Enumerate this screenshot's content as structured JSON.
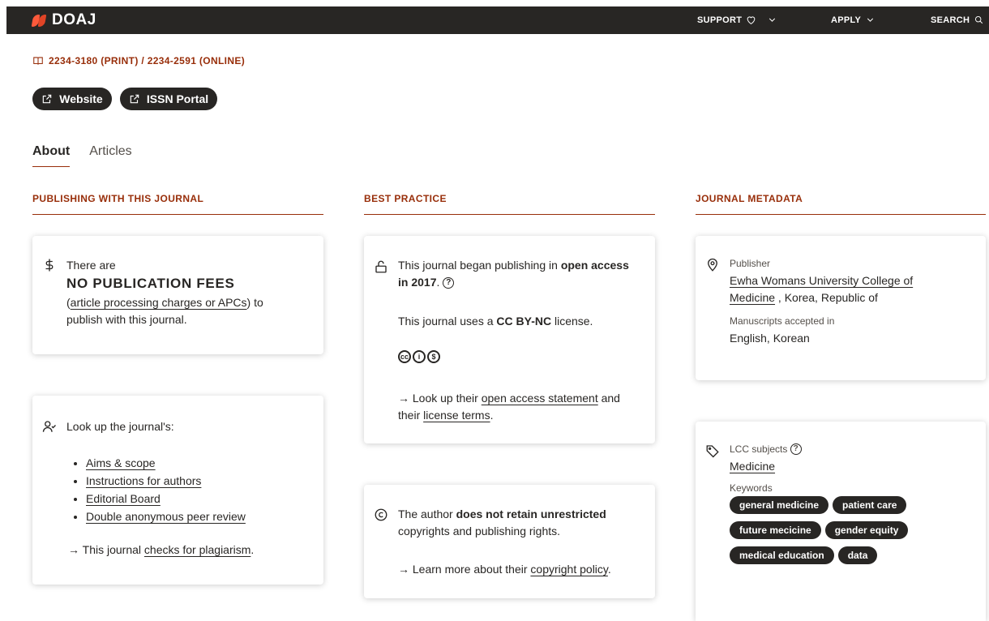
{
  "header": {
    "logo": "DOAJ",
    "support": "SUPPORT",
    "apply": "APPLY",
    "search": "SEARCH"
  },
  "issn": "2234-3180 (PRINT) / 2234-2591 (ONLINE)",
  "buttons": {
    "website": "Website",
    "issn_portal": "ISSN Portal"
  },
  "tabs": {
    "about": "About",
    "articles": "Articles"
  },
  "sections": {
    "publishing": "PUBLISHING WITH THIS JOURNAL",
    "best_practice": "BEST PRACTICE",
    "metadata": "JOURNAL METADATA"
  },
  "fees_card": {
    "there_are": "There are",
    "headline": "NO PUBLICATION FEES",
    "apc_link": "article processing charges or APCs",
    "suffix": ") to",
    "line3": "publish with this journal."
  },
  "lookup_card": {
    "title": "Look up the journal's:",
    "links": [
      "Aims & scope",
      "Instructions for authors",
      "Editorial Board",
      "Double anonymous peer review"
    ],
    "plagiarism_prefix": "→ This journal ",
    "plagiarism_link": "checks for plagiarism",
    "plagiarism_suffix": "."
  },
  "oa_card": {
    "line1": "This journal began publishing in ",
    "oa_bold1": "open access",
    "oa_bold2": "in 2017",
    "dot": ".",
    "license_prefix": "This journal uses a ",
    "license_bold": "CC BY-NC",
    "license_suffix": " license.",
    "lookup_prefix": "→ Look up their ",
    "oa_statement": "open access statement",
    "and": " and",
    "their": "their ",
    "license_terms": "license terms",
    "period": "."
  },
  "copyright_card": {
    "prefix": "The author ",
    "bold": "does not retain unrestricted",
    "line2": "copyrights and publishing rights.",
    "learn_prefix": "→ Learn more about their ",
    "learn_link": "copyright policy",
    "period": "."
  },
  "publisher_card": {
    "label": "Publisher",
    "publisher_line1": "Ewha Womans University College of",
    "publisher_line2": "Medicine",
    "location": " , Korea, Republic of",
    "manuscripts_label": "Manuscripts accepted in",
    "languages": "English, Korean"
  },
  "subjects_card": {
    "lcc_label": "LCC subjects",
    "lcc_subject": "Medicine",
    "keywords_label": "Keywords",
    "keywords": [
      "general medicine",
      "patient care",
      "future mecicine",
      "gender equity",
      "medical education",
      "data"
    ]
  },
  "colors": {
    "dark": "#282624",
    "accent": "#982e0a",
    "logo_orange": "#fd5a3b"
  }
}
